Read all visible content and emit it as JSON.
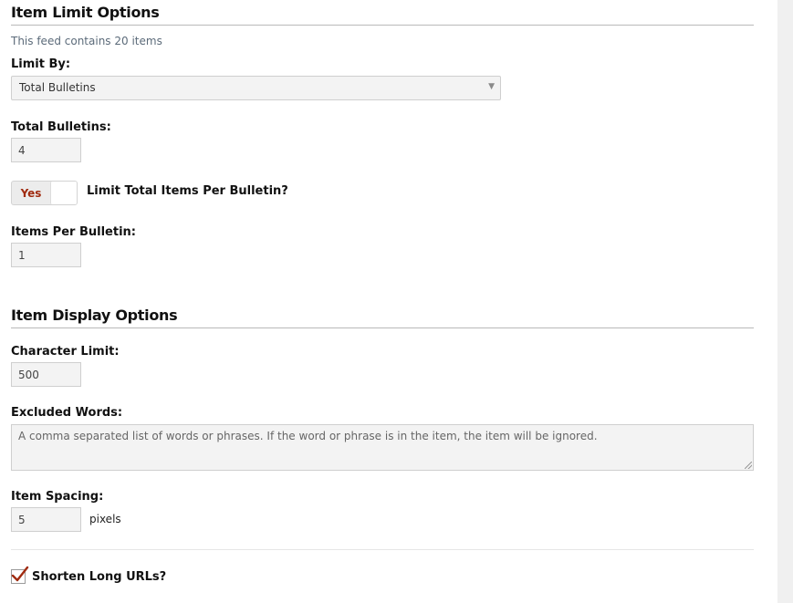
{
  "limit_section": {
    "heading": "Item Limit Options",
    "feed_info": "This feed contains 20 items",
    "limit_by_label": "Limit By:",
    "limit_by_value": "Total Bulletins",
    "total_bulletins_label": "Total Bulletins:",
    "total_bulletins_value": "4",
    "limit_toggle_state": "Yes",
    "limit_toggle_label": "Limit Total Items Per Bulletin?",
    "items_per_bulletin_label": "Items Per Bulletin:",
    "items_per_bulletin_value": "1"
  },
  "display_section": {
    "heading": "Item Display Options",
    "character_limit_label": "Character Limit:",
    "character_limit_value": "500",
    "excluded_words_label": "Excluded Words:",
    "excluded_words_placeholder": "A comma separated list of words or phrases. If the word or phrase is in the item, the item will be ignored.",
    "item_spacing_label": "Item Spacing:",
    "item_spacing_value": "5",
    "item_spacing_unit": "pixels",
    "shorten_urls_label": "Shorten Long URLs?",
    "shorten_urls_checked": true
  },
  "colors": {
    "toggle_text": "#a02b10",
    "checkmark": "#a02b10",
    "input_bg": "#f3f3f3"
  }
}
